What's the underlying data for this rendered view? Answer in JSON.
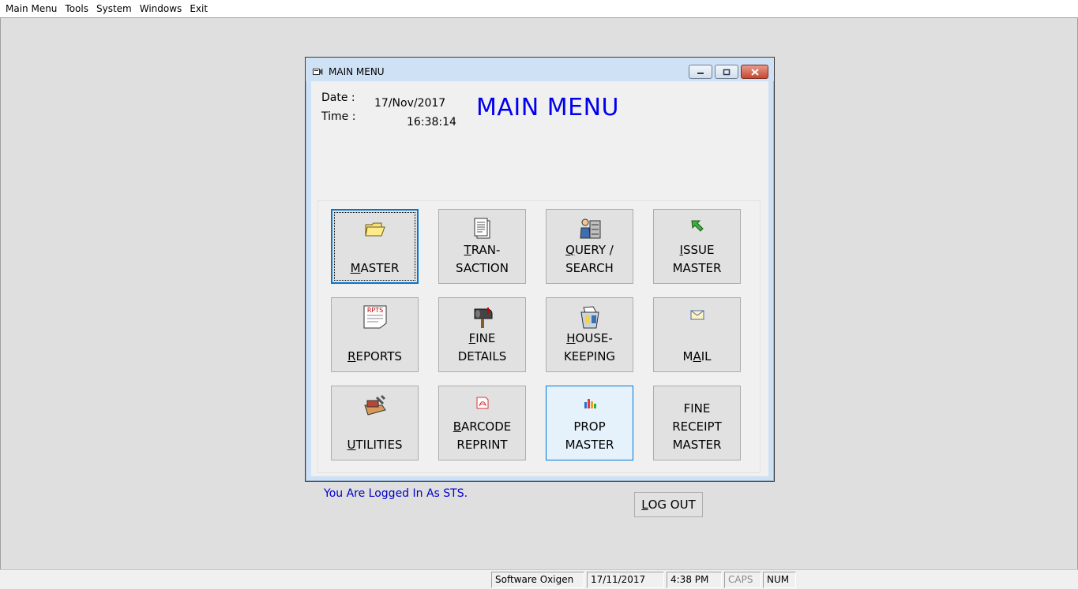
{
  "menubar": {
    "items": [
      "Main Menu",
      "Tools",
      "System",
      "Windows",
      "Exit"
    ]
  },
  "window": {
    "title": "MAIN MENU",
    "date_label": "Date :",
    "time_label": "Time :",
    "date_value": "17/Nov/2017",
    "time_value": "16:38:14",
    "heading": "MAIN MENU"
  },
  "tiles": {
    "master": {
      "l1": "",
      "l2a": "M",
      "l2b": "ASTER",
      "icon": "folder-icon"
    },
    "transaction": {
      "l1a": "T",
      "l1b": "RAN-",
      "l2": "SACTION",
      "icon": "document-icon"
    },
    "query": {
      "l1a": "Q",
      "l1b": "UERY /",
      "l2": "SEARCH",
      "icon": "person-cabinet-icon"
    },
    "issue": {
      "l1a": "I",
      "l1b": "SSUE",
      "l2": "MASTER",
      "icon": "green-arrow-icon"
    },
    "reports": {
      "l2a": "R",
      "l2b": "EPORTS",
      "icon_text": "RPTS",
      "icon": "report-icon"
    },
    "fine": {
      "l1a": "F",
      "l1b": "INE",
      "l2": "DETAILS",
      "icon": "mailbox-icon"
    },
    "housekeeping": {
      "l1a": "H",
      "l1b": "OUSE-",
      "l2": "KEEPING",
      "icon": "recycle-bin-icon"
    },
    "mail": {
      "l2a": "M",
      "l2u": "A",
      "l2b": "IL",
      "icon": "envelope-icon"
    },
    "utilities": {
      "l2a": "U",
      "l2b": "TILITIES",
      "icon": "toolbox-icon"
    },
    "barcode": {
      "l1a": "B",
      "l1b": "ARCODE",
      "l2": "REPRINT",
      "icon": "pdf-icon"
    },
    "prop": {
      "l1": "PROP",
      "l2": "MASTER",
      "icon": "bar-chart-icon"
    },
    "finereceipt": {
      "l1": "FINE",
      "l2": "RECEIPT",
      "l3": "MASTER"
    }
  },
  "footer": {
    "logged_in": "You Are Logged In As STS.",
    "logout_a": "L",
    "logout_b": "OG OUT"
  },
  "statusbar": {
    "app": "Software Oxigen",
    "date": "17/11/2017",
    "time": "4:38 PM",
    "caps": "CAPS",
    "num": "NUM"
  }
}
